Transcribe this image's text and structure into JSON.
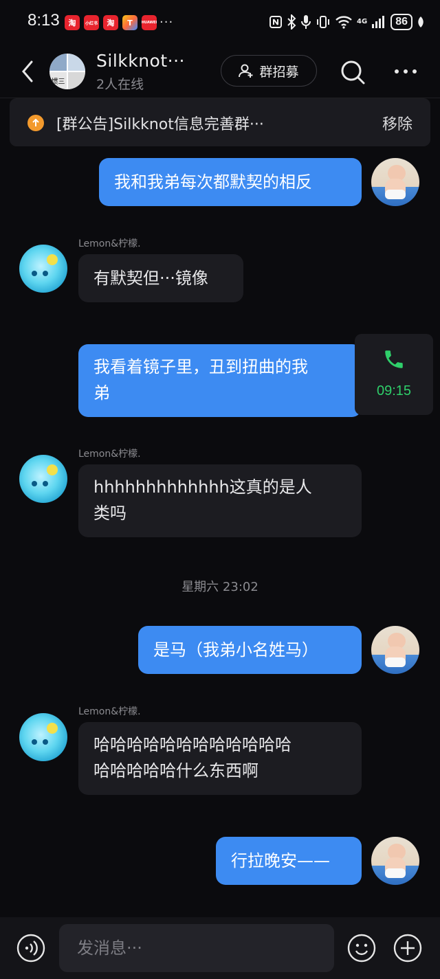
{
  "status": {
    "time": "8:13",
    "app_icons": [
      "淘",
      "小红书",
      "淘",
      "T",
      "HUAWEI"
    ],
    "more": "···",
    "battery": "86",
    "net": "4G"
  },
  "header": {
    "title": "Silkknot···",
    "subtitle": "2人在线",
    "avatar_text": "惯三",
    "recruit_label": "群招募"
  },
  "notice": {
    "text": "[群公告]Silkknot信息完善群···",
    "remove_label": "移除"
  },
  "messages": [
    {
      "text": "我和我弟每次都默契的相反"
    },
    {
      "sender": "Lemon&柠檬.",
      "text": "有默契但···镜像"
    },
    {
      "text_line1": "我看着镜子里，丑到扭曲的我",
      "text_line2": "弟"
    },
    {
      "sender": "Lemon&柠檬.",
      "text_line1": "hhhhhhhhhhhhh这真的是人",
      "text_line2": "类吗"
    },
    {
      "text": "是马（我弟小名姓马）"
    },
    {
      "sender": "Lemon&柠檬.",
      "text_line1": "哈哈哈哈哈哈哈哈哈哈哈哈",
      "text_line2": "哈哈哈哈哈什么东西啊"
    },
    {
      "text": "行拉晚安——"
    }
  ],
  "call": {
    "time": "09:15"
  },
  "timestamp": "星期六 23:02",
  "input": {
    "placeholder": "发消息···"
  },
  "colors": {
    "accent": "#3d8bf2",
    "call_green": "#2fcf6a",
    "notice_orange": "#f39a2d"
  }
}
